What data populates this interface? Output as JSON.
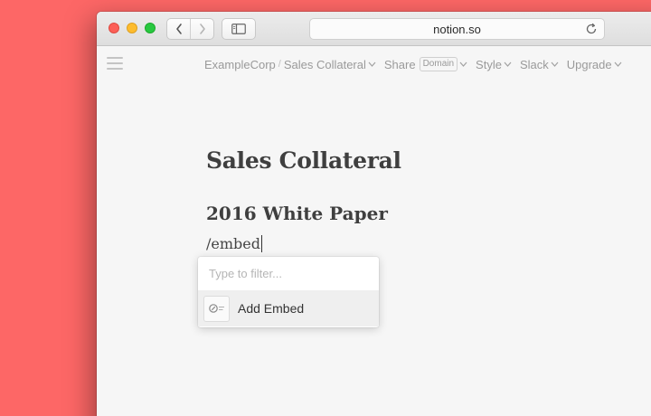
{
  "browser": {
    "url": "notion.so"
  },
  "nav": {
    "breadcrumb": [
      "ExampleCorp",
      "Sales Collateral"
    ],
    "breadcrumb_separator": "/",
    "share_label": "Share",
    "share_badge": "Domain",
    "style_label": "Style",
    "slack_label": "Slack",
    "upgrade_label": "Upgrade"
  },
  "page": {
    "title": "Sales Collateral",
    "heading": "2016 White Paper",
    "command_text": "/embed"
  },
  "slash_menu": {
    "filter_placeholder": "Type to filter...",
    "items": [
      {
        "label": "Add Embed",
        "icon": "embed-icon"
      }
    ]
  },
  "colors": {
    "background": "#fd6766",
    "page": "#f6f6f6",
    "text": "#3f3f3f",
    "muted": "#9a9a9a"
  }
}
